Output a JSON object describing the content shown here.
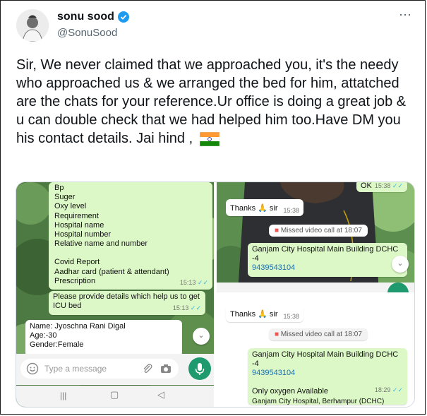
{
  "author": {
    "name": "sonu sood",
    "handle": "@SonuSood"
  },
  "tweet": {
    "text": "Sir, We never claimed that we approached you, it's the needy who  approached us & we arranged the bed for him, attatched are the chats for your reference.Ur office is doing a great job & u can double check that we had helped him too.Have DM you his contact details. Jai hind ,",
    "flag_icon": "india-flag-emoji"
  },
  "more_icon": "⋯",
  "left_chat": {
    "list_lines": [
      "Bp",
      "Suger",
      "Oxy level",
      "Requirement",
      "Hospital name",
      "Hospital number",
      "Relative name and number",
      "",
      "Covid Report",
      "Aadhar card (patient & attendant)",
      "Prescription"
    ],
    "list_time": "15:13",
    "request_text": "Please provide details which help us to get  ICU bed",
    "request_time": "15:13",
    "reply_lines": [
      "Name: Jyoschna Rani Digal",
      "Age:-30",
      "Gender:Female"
    ],
    "input_placeholder": "Type a message",
    "nav_icons": [
      "|||",
      "▢",
      "◁"
    ]
  },
  "right_top": {
    "ok_text": "OK",
    "ok_time": "15:38",
    "thanks_text": "Thanks 🙏 sir",
    "thanks_time": "15:38",
    "missed_call": "Missed video call at 18:07",
    "hospital_text": "Ganjam City Hospital Main Building DCHC -4",
    "phone": "9439543104"
  },
  "right_bottom": {
    "thanks_text": "Thanks 🙏 sir",
    "thanks_time": "15:38",
    "missed_call": "Missed video call at 18:07",
    "hospital_text": "Ganjam City Hospital Main Building DCHC -4",
    "phone": "9439543104",
    "oxygen_text": "Only oxygen Available",
    "oxygen_time": "18:29",
    "partial_text": "Ganjam City Hospital, Berhampur (DCHC)"
  },
  "colors": {
    "whatsapp_green": "#1f9a6e",
    "bubble_green": "#dcf8c6",
    "verified": "#1d9bf0"
  }
}
